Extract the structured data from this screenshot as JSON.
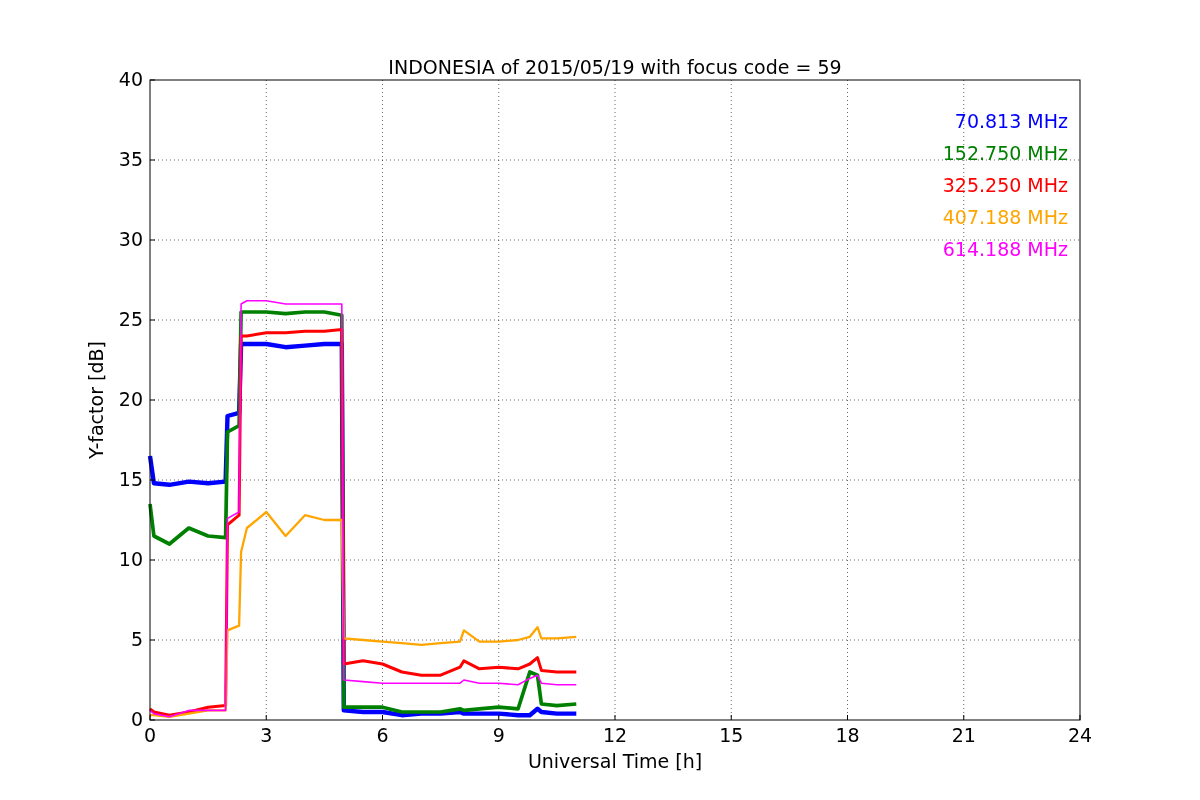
{
  "figure": {
    "chart_data": {
      "type": "line",
      "title": "INDONESIA of 2015/05/19 with focus code = 59",
      "xlabel": "Universal Time [h]",
      "ylabel": "Y-factor [dB]",
      "x": [
        0,
        0.1,
        0.5,
        1,
        1.5,
        1.95,
        2.0,
        2.3,
        2.35,
        2.5,
        3,
        3.5,
        4,
        4.5,
        4.95,
        5.0,
        5.5,
        6,
        6.5,
        7,
        7.5,
        8,
        8.1,
        8.5,
        9,
        9.5,
        9.8,
        10,
        10.1,
        10.5,
        11
      ],
      "series": [
        {
          "name": "70.813 MHz",
          "color": "#0000ff",
          "values": [
            16.5,
            14.8,
            14.7,
            14.9,
            14.8,
            14.9,
            19,
            19.2,
            23.5,
            23.5,
            23.5,
            23.3,
            23.4,
            23.5,
            23.5,
            0.6,
            0.5,
            0.5,
            0.3,
            0.4,
            0.4,
            0.5,
            0.4,
            0.4,
            0.4,
            0.3,
            0.3,
            0.7,
            0.5,
            0.4,
            0.4
          ]
        },
        {
          "name": "152.750 MHz",
          "color": "#008000",
          "values": [
            13.5,
            11.5,
            11,
            12,
            11.5,
            11.4,
            18,
            18.4,
            25.5,
            25.5,
            25.5,
            25.4,
            25.5,
            25.5,
            25.3,
            0.8,
            0.8,
            0.8,
            0.5,
            0.5,
            0.5,
            0.7,
            0.6,
            0.7,
            0.8,
            0.7,
            3,
            2.8,
            1,
            0.9,
            1
          ]
        },
        {
          "name": "325.250 MHz",
          "color": "#ff0000",
          "values": [
            0.7,
            0.5,
            0.3,
            0.5,
            0.8,
            0.9,
            12.2,
            12.8,
            24,
            24,
            24.2,
            24.2,
            24.3,
            24.3,
            24.4,
            3.5,
            3.7,
            3.5,
            3,
            2.8,
            2.8,
            3.3,
            3.7,
            3.2,
            3.3,
            3.2,
            3.5,
            3.9,
            3.1,
            3,
            3
          ]
        },
        {
          "name": "407.188 MHz",
          "color": "#ffa500",
          "values": [
            0.3,
            0.3,
            0.2,
            0.4,
            0.6,
            0.6,
            5.6,
            5.9,
            10.5,
            12,
            13,
            11.5,
            12.8,
            12.5,
            12.5,
            5.1,
            5,
            4.9,
            4.8,
            4.7,
            4.8,
            4.9,
            5.6,
            4.9,
            4.9,
            5,
            5.2,
            5.8,
            5.1,
            5.1,
            5.2
          ]
        },
        {
          "name": "614.188 MHz",
          "color": "#ff00ff",
          "values": [
            0.6,
            0.4,
            0.2,
            0.6,
            0.6,
            0.6,
            12.6,
            13,
            26,
            26.2,
            26.2,
            26,
            26,
            26,
            26,
            2.5,
            2.4,
            2.3,
            2.3,
            2.3,
            2.3,
            2.3,
            2.5,
            2.3,
            2.3,
            2.2,
            2.6,
            2.8,
            2.3,
            2.2,
            2.2
          ]
        }
      ],
      "grid": true,
      "xlim": [
        0,
        24
      ],
      "ylim": [
        0,
        40
      ],
      "xticks": [
        0,
        3,
        6,
        9,
        12,
        15,
        18,
        21,
        24
      ],
      "yticks": [
        0,
        5,
        10,
        15,
        20,
        25,
        30,
        35,
        40
      ]
    }
  }
}
